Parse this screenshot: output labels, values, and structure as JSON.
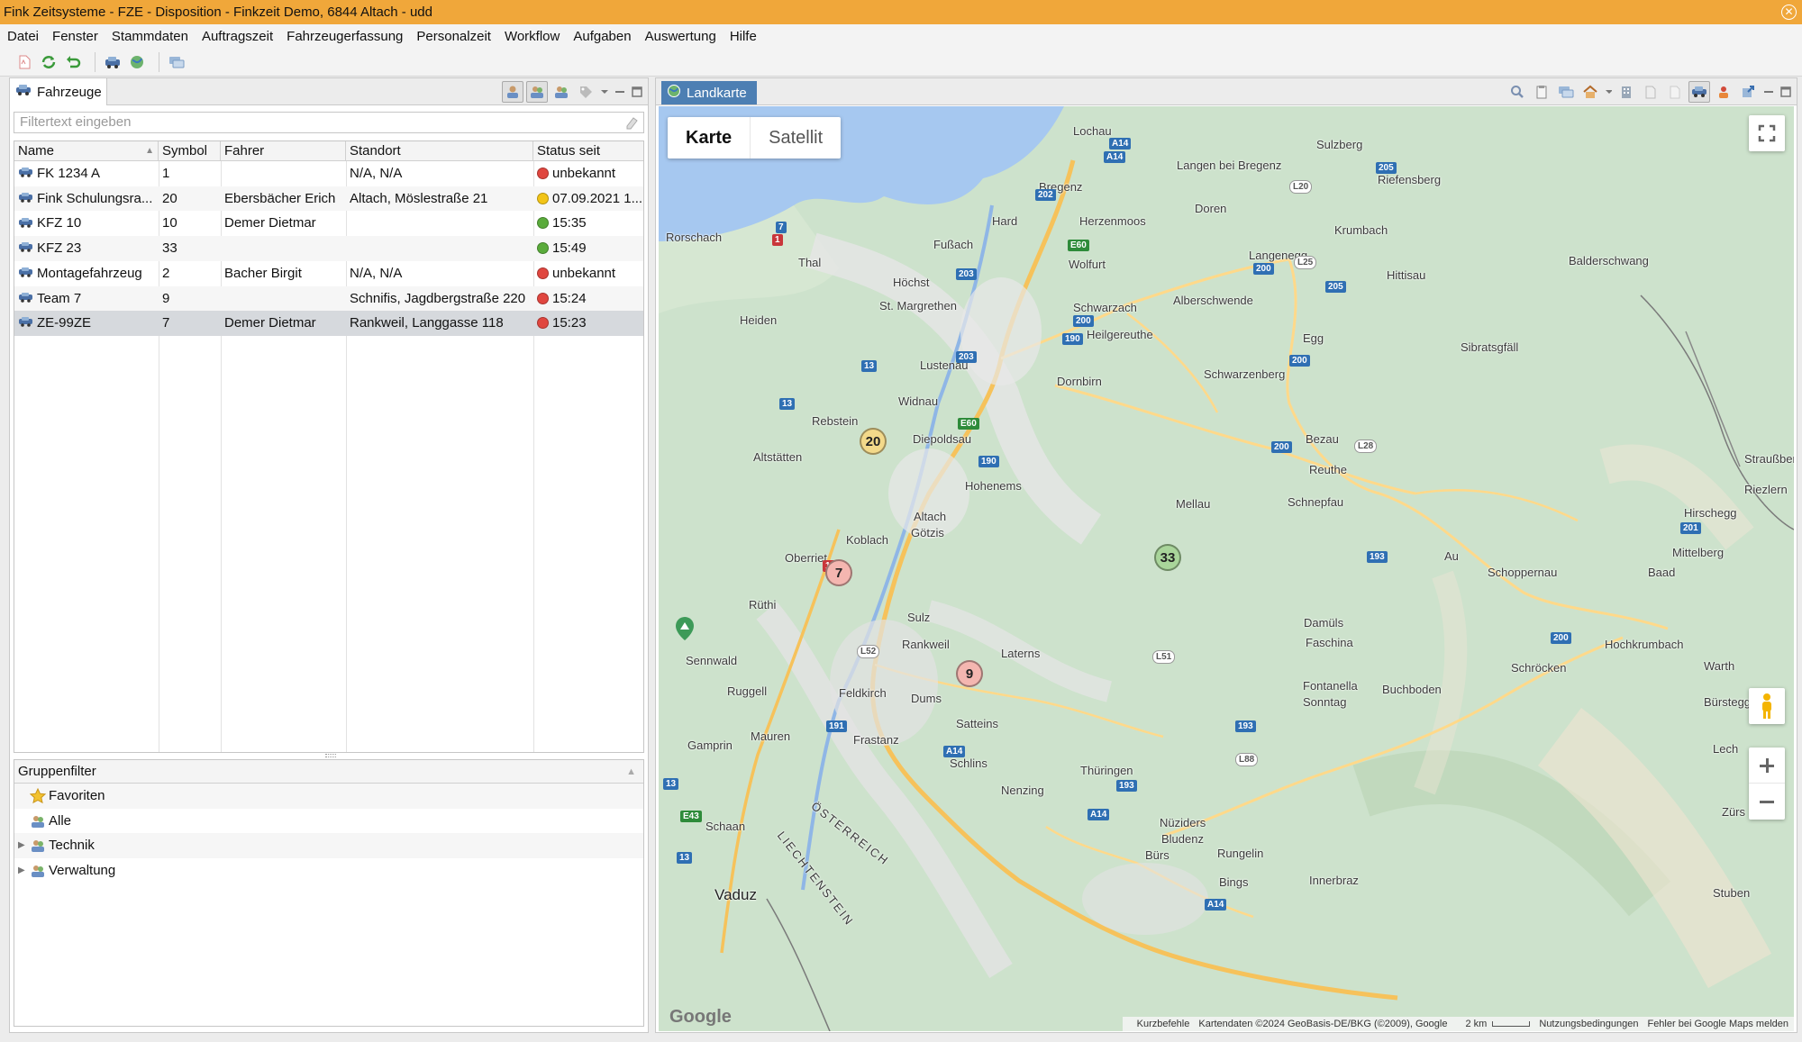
{
  "window": {
    "title": "Fink Zeitsysteme - FZE - Disposition - Finkzeit Demo, 6844 Altach - udd"
  },
  "menu": [
    "Datei",
    "Fenster",
    "Stammdaten",
    "Auftragszeit",
    "Fahrzeugerfassung",
    "Personalzeit",
    "Workflow",
    "Aufgaben",
    "Auswertung",
    "Hilfe"
  ],
  "left": {
    "tab_label": "Fahrzeuge",
    "filter_placeholder": "Filtertext eingeben",
    "columns": [
      "Name",
      "Symbol",
      "Fahrer",
      "Standort",
      "Status seit"
    ],
    "rows": [
      {
        "name": "FK 1234 A",
        "symbol": "1",
        "driver": "",
        "location": "N/A, N/A",
        "status": "unbekannt",
        "status_color": "#e0463f"
      },
      {
        "name": "Fink Schulungsra...",
        "symbol": "20",
        "driver": "Ebersbächer Erich",
        "location": "Altach, Möslestraße 21",
        "status": "07.09.2021 1...",
        "status_color": "#f2c417"
      },
      {
        "name": "KFZ 10",
        "symbol": "10",
        "driver": "Demer Dietmar",
        "location": "",
        "status": "15:35",
        "status_color": "#5aab3b"
      },
      {
        "name": "KFZ 23",
        "symbol": "33",
        "driver": "",
        "location": "",
        "status": "15:49",
        "status_color": "#5aab3b"
      },
      {
        "name": "Montagefahrzeug",
        "symbol": "2",
        "driver": "Bacher Birgit",
        "location": "N/A, N/A",
        "status": "unbekannt",
        "status_color": "#e0463f"
      },
      {
        "name": "Team 7",
        "symbol": "9",
        "driver": "",
        "location": "Schnifis, Jagdbergstraße 220",
        "status": "15:24",
        "status_color": "#e0463f"
      },
      {
        "name": "ZE-99ZE",
        "symbol": "7",
        "driver": "Demer Dietmar",
        "location": "Rankweil, Langgasse 118",
        "status": "15:23",
        "status_color": "#e0463f"
      }
    ],
    "group_filter": {
      "title": "Gruppenfilter",
      "items": [
        {
          "label": "Favoriten",
          "icon": "star-icon",
          "expandable": false
        },
        {
          "label": "Alle",
          "icon": "group-icon",
          "expandable": false
        },
        {
          "label": "Technik",
          "icon": "group-icon",
          "expandable": true
        },
        {
          "label": "Verwaltung",
          "icon": "group-icon",
          "expandable": true
        }
      ]
    }
  },
  "right": {
    "tab_label": "Landkarte",
    "map": {
      "type_active": "Karte",
      "type_inactive": "Satellit",
      "markers": [
        {
          "label": "20",
          "color": "#f3d98a"
        },
        {
          "label": "7",
          "color": "#f4b6b0"
        },
        {
          "label": "9",
          "color": "#f4b6b0"
        },
        {
          "label": "33",
          "color": "#a9d59a"
        }
      ],
      "places": [
        "Lochau",
        "Bregenz",
        "Langen bei Bregenz",
        "Sulzberg",
        "Riefensberg",
        "Rorschach",
        "Thal",
        "Fußach",
        "Hard",
        "Herzenmoos",
        "Doren",
        "Krumbach",
        "Höchst",
        "Wolfurt",
        "Langenegg",
        "Hittisau",
        "Balderschwang",
        "Heiden",
        "St. Margrethen",
        "Schwarzach",
        "Alberschwende",
        "Heilgereuthe",
        "Egg",
        "Lustenau",
        "Sibratsgfäll",
        "Widnau",
        "Dornbirn",
        "Schwarzenberg",
        "Rebstein",
        "Diepoldsau",
        "Bezau",
        "Altstätten",
        "Reuthe",
        "Hohenems",
        "Straußberg",
        "Riezlern",
        "Mellau",
        "Schnepfau",
        "Hirschegg",
        "Götzis",
        "Altach",
        "Koblach",
        "Oberriet",
        "Au",
        "Mittelberg",
        "Schoppernau",
        "Baad",
        "Rüthi",
        "Sulz",
        "Damüls",
        "Faschina",
        "Sennwald",
        "Rankweil",
        "Laterns",
        "Hochkrumbach",
        "Schröcken",
        "Warth",
        "Fontanella",
        "Buchboden",
        "Ruggell",
        "Feldkirch",
        "Dums",
        "Sonntag",
        "Bürstegg",
        "Satteins",
        "Gamprin",
        "Mauren",
        "Frastanz",
        "Lech",
        "Schlins",
        "Thüringen",
        "Nenzing",
        "Nüziders",
        "Schaan",
        "ÖSTERREICH",
        "LIECHTENSTEIN",
        "Bludenz",
        "Bürs",
        "Rungelin",
        "Bings",
        "Innerbraz",
        "Stuben",
        "Vaduz",
        "Zürs"
      ],
      "attribution": {
        "shortcuts": "Kurzbefehle",
        "data": "Kartendaten ©2024 GeoBasis-DE/BKG (©2009), Google",
        "scale": "2 km",
        "terms": "Nutzungsbedingungen",
        "report": "Fehler bei Google Maps melden"
      },
      "logo": "Google"
    }
  }
}
